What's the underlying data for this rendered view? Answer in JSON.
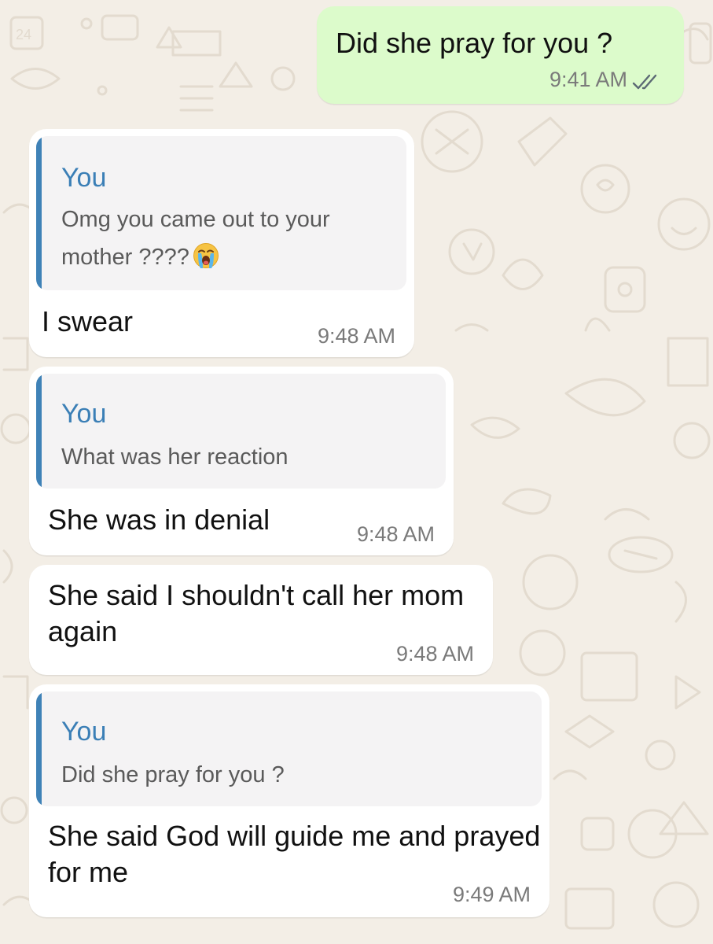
{
  "messages": [
    {
      "direction": "out",
      "text": "Did she pray for you ?",
      "time": "9:41 AM",
      "status_icon": "double-check-icon"
    },
    {
      "direction": "in",
      "quote": {
        "author": "You",
        "text": "Omg you came out to your mother ????",
        "emoji_icon": "loudly-crying-face-icon"
      },
      "text": "I swear",
      "time": "9:48 AM"
    },
    {
      "direction": "in",
      "quote": {
        "author": "You",
        "text": "What was her reaction"
      },
      "text": "She was in denial",
      "time": "9:48 AM"
    },
    {
      "direction": "in",
      "text": "She said I shouldn't call her mom again",
      "time": "9:48 AM"
    },
    {
      "direction": "in",
      "quote": {
        "author": "You",
        "text": "Did she pray for you ?"
      },
      "text": "She said God will guide me and prayed for me",
      "time": "9:49 AM"
    }
  ],
  "colors": {
    "wallpaper": "#f3eee6",
    "outgoing_bubble": "#dcfbcb",
    "incoming_bubble": "#ffffff",
    "quote_accent": "#3f82b7",
    "quote_background": "#f4f3f4",
    "timestamp": "#7a7a7a"
  }
}
